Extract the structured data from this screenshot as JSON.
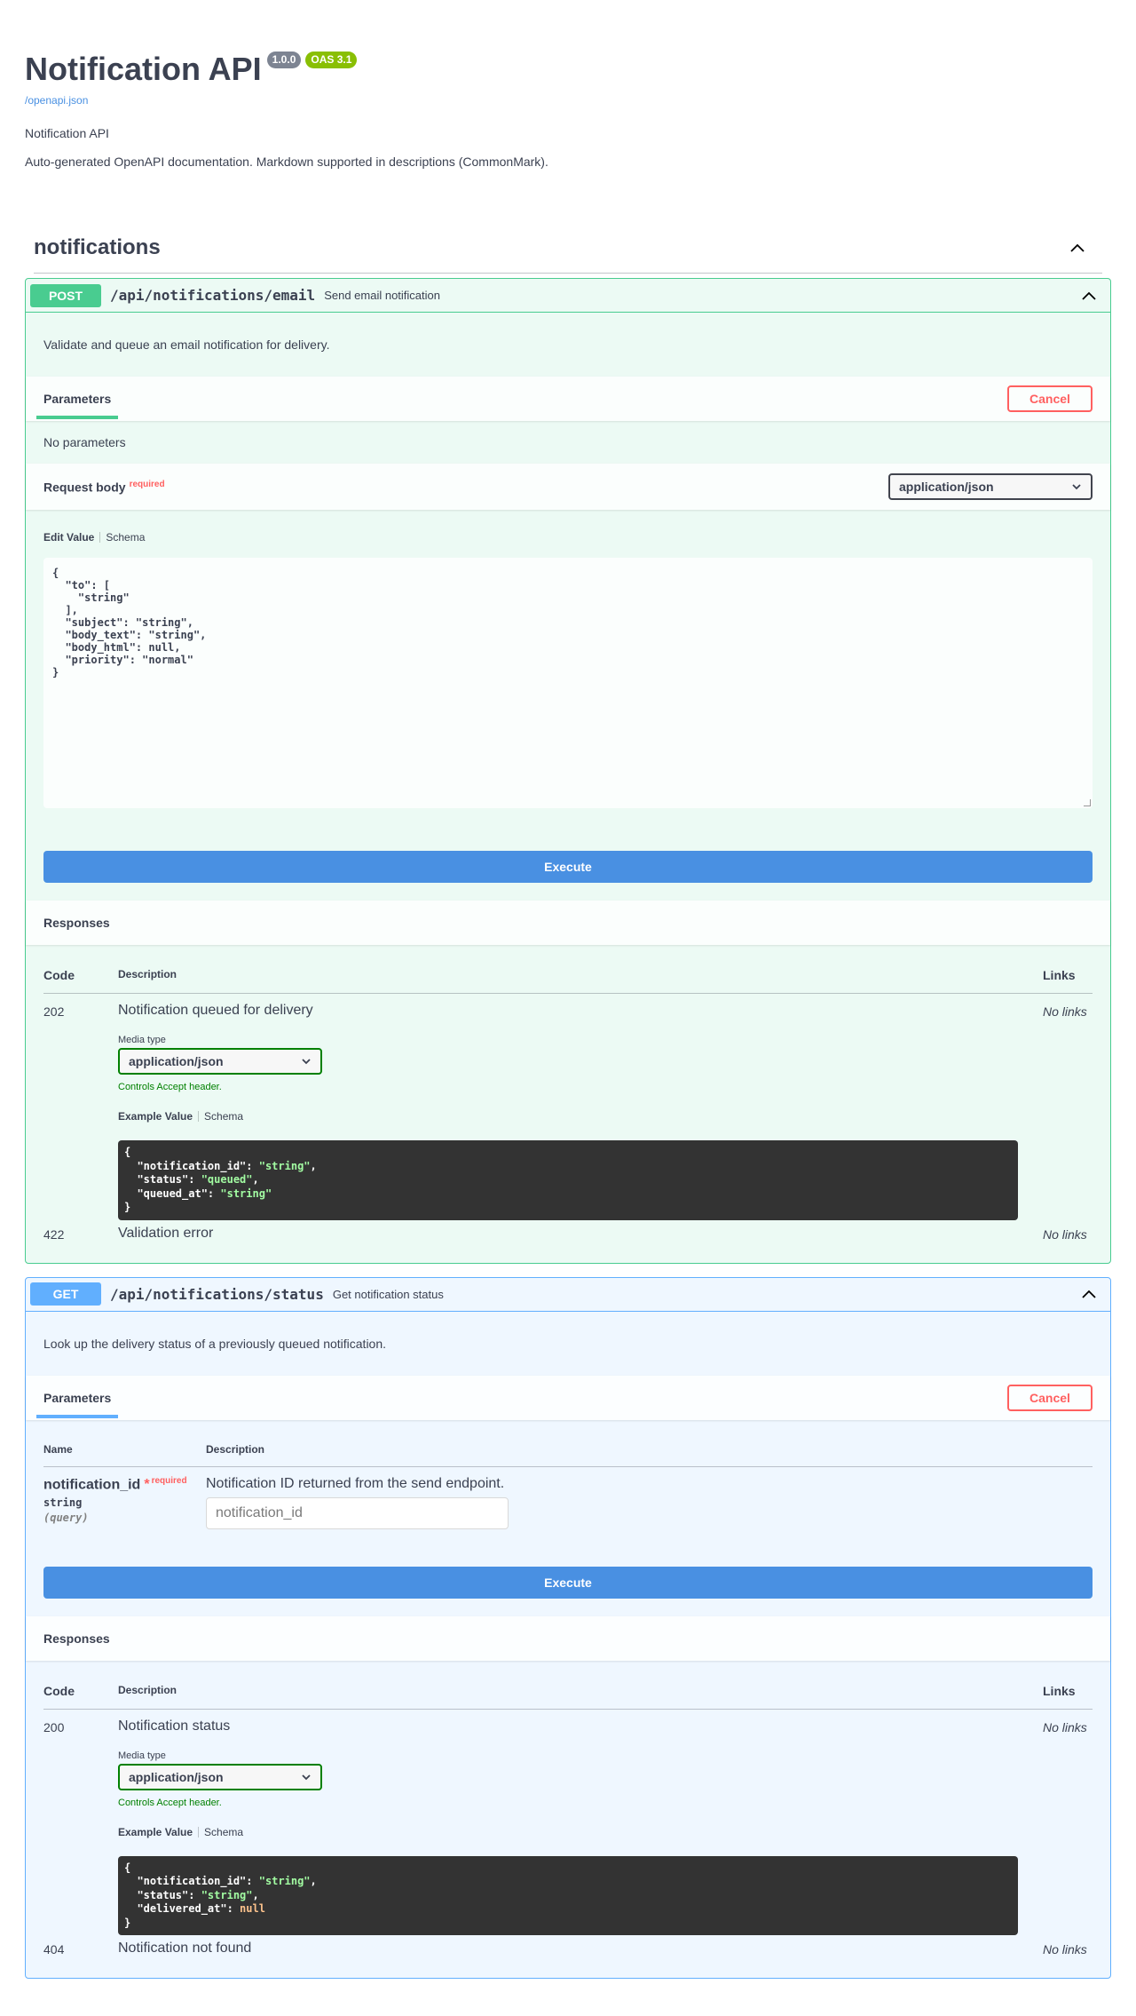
{
  "info": {
    "title": "Notification API",
    "version": "1.0.0",
    "oas": "OAS 3.1",
    "spec_link": "/openapi.json",
    "subtitle": "Notification API",
    "description": "Auto-generated OpenAPI documentation. Markdown supported in descriptions (CommonMark)."
  },
  "tag": {
    "name": "notifications"
  },
  "ops": {
    "post": {
      "method": "POST",
      "path": "/api/notifications/email",
      "summary": "Send email notification",
      "description": "Validate and queue an email notification for delivery.",
      "parameters_tab": "Parameters",
      "cancel": "Cancel",
      "no_params": "No parameters",
      "request_body": "Request body",
      "required": "required",
      "content_type": "application/json",
      "edit_value": "Edit Value",
      "schema": "Schema",
      "body_json": "{\n  \"to\": [\n    \"string\"\n  ],\n  \"subject\": \"string\",\n  \"body_text\": \"string\",\n  \"body_html\": null,\n  \"priority\": \"normal\"\n}",
      "execute": "Execute",
      "responses": "Responses",
      "col_code": "Code",
      "col_desc": "Description",
      "col_links": "Links",
      "r1_code": "202",
      "r1_desc": "Notification queued for delivery",
      "r1_links": "No links",
      "media_type_label": "Media type",
      "media_type": "application/json",
      "controls": "Controls Accept header.",
      "example_value": "Example Value",
      "example_schema": "Schema",
      "r2_code": "422",
      "r2_desc": "Validation error",
      "r2_links": "No links"
    },
    "get": {
      "method": "GET",
      "path": "/api/notifications/status",
      "summary": "Get notification status",
      "description": "Look up the delivery status of a previously queued notification.",
      "parameters_tab": "Parameters",
      "cancel": "Cancel",
      "col_name": "Name",
      "col_description": "Description",
      "param_name": "notification_id",
      "param_star": "*",
      "param_required": "required",
      "param_type": "string",
      "param_in": "(query)",
      "param_desc": "Notification ID returned from the send endpoint.",
      "param_placeholder": "notification_id",
      "execute": "Execute",
      "responses": "Responses",
      "col_code": "Code",
      "col_desc": "Description",
      "col_links": "Links",
      "r1_code": "200",
      "r1_desc": "Notification status",
      "r1_links": "No links",
      "media_type_label": "Media type",
      "media_type": "application/json",
      "controls": "Controls Accept header.",
      "example_value": "Example Value",
      "example_schema": "Schema",
      "r2_code": "404",
      "r2_desc": "Notification not found",
      "r2_links": "No links"
    }
  },
  "examples": {
    "post_lines": [
      {
        "pre": "{",
        "val": "",
        "post": "",
        "kind": ""
      },
      {
        "pre": "  \"notification_id\": ",
        "val": "\"string\"",
        "post": ",",
        "kind": "str"
      },
      {
        "pre": "  \"status\": ",
        "val": "\"queued\"",
        "post": ",",
        "kind": "str"
      },
      {
        "pre": "  \"queued_at\": ",
        "val": "\"string\"",
        "post": "",
        "kind": "str"
      },
      {
        "pre": "}",
        "val": "",
        "post": "",
        "kind": ""
      }
    ],
    "get_lines": [
      {
        "pre": "{",
        "val": "",
        "post": "",
        "kind": ""
      },
      {
        "pre": "  \"notification_id\": ",
        "val": "\"string\"",
        "post": ",",
        "kind": "str"
      },
      {
        "pre": "  \"status\": ",
        "val": "\"string\"",
        "post": ",",
        "kind": "str"
      },
      {
        "pre": "  \"delivered_at\": ",
        "val": "null",
        "post": "",
        "kind": "nul"
      },
      {
        "pre": "}",
        "val": "",
        "post": "",
        "kind": ""
      }
    ]
  },
  "colors": {
    "post": "#49cc90",
    "get": "#61affe",
    "execute": "#4990e2",
    "cancel": "#ff6060",
    "version_badge": "#7d8492",
    "oas_badge": "#89bf04"
  },
  "icons": {
    "collapse": "chevron-up-icon",
    "dropdown": "chevron-down-icon"
  }
}
